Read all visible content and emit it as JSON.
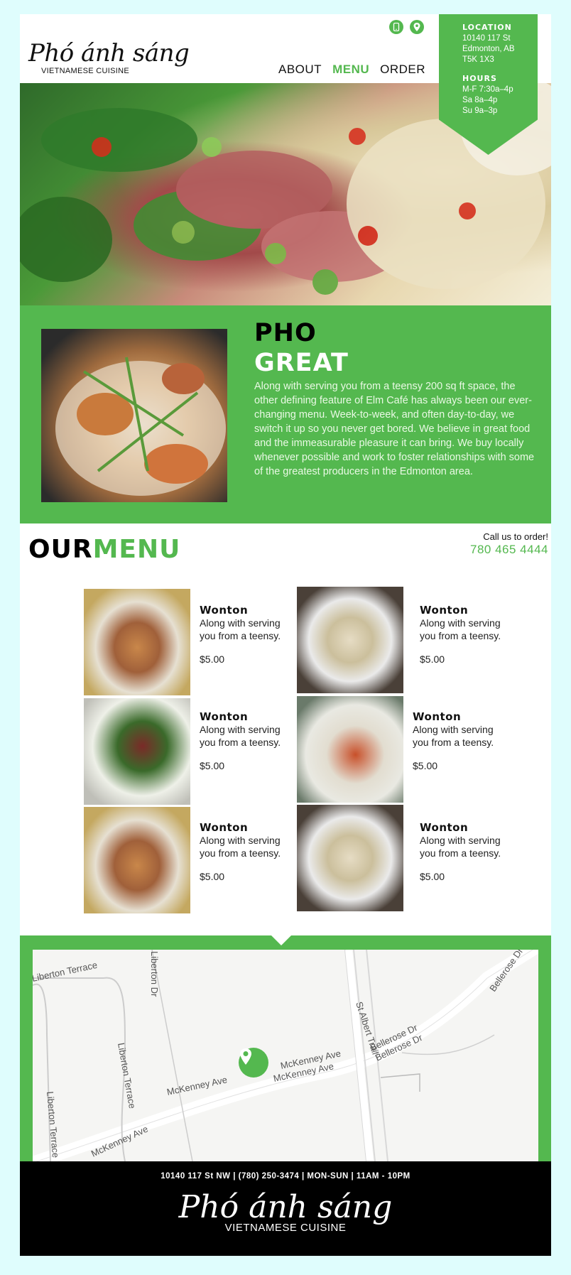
{
  "brand": {
    "name": "Phó ánh sáng",
    "tagline": "VIETNAMESE CUISINE"
  },
  "header": {
    "icons": [
      "phone-icon",
      "location-pin-icon"
    ],
    "nav": [
      {
        "label": "ABOUT",
        "active": false
      },
      {
        "label": "MENU",
        "active": true
      },
      {
        "label": "ORDER",
        "active": false
      }
    ]
  },
  "info": {
    "location_title": "LOCATION",
    "address": [
      "10140 117 St",
      "Edmonton, AB",
      "T5K 1X3"
    ],
    "hours_title": "HOURS",
    "hours": [
      "M-F 7:30a–4p",
      "Sa 8a–4p",
      "Su 9a–3p"
    ]
  },
  "intro": {
    "title_1": "PHO",
    "title_2": "GREAT",
    "text": "Along with serving you from a teensy 200 sq ft space, the other defining feature of Elm Café has always been our ever-changing menu. Week-to-week, and often day-to-day, we switch it up so you never get bored. We believe in great food and the immeasurable pleasure it can bring. We buy locally whenever possible and work to foster relationships with some of the greatest producers in the Edmonton area."
  },
  "menu": {
    "title_1": "OUR",
    "title_2": "MENU",
    "call_label": "Call us to order!",
    "call_number": "780 465 4444",
    "items": [
      {
        "name": "Wonton",
        "desc": "Along with serving you from a teensy.",
        "price": "$5.00"
      },
      {
        "name": "Wonton",
        "desc": "Along with serving you from a teensy.",
        "price": "$5.00"
      },
      {
        "name": "Wonton",
        "desc": "Along with serving you from a teensy.",
        "price": "$5.00"
      },
      {
        "name": "Wonton",
        "desc": "Along with serving you from a teensy.",
        "price": "$5.00"
      },
      {
        "name": "Wonton",
        "desc": "Along with serving you from a teensy.",
        "price": "$5.00"
      },
      {
        "name": "Wonton",
        "desc": "Along with serving you from a teensy.",
        "price": "$5.00"
      }
    ]
  },
  "map": {
    "labels": [
      "Liberton Terrace",
      "Liberton Dr",
      "Liberton Terrace",
      "Liberton Terrace",
      "McKenney Ave",
      "McKenney Ave",
      "McKenney Ave",
      "McKenney Ave",
      "St Albert Trail",
      "Bellerose Dr",
      "Bellerose Dr",
      "Bellerose Dr"
    ]
  },
  "footer": {
    "line": "10140 117 St NW | (780) 250-3474 | MON-SUN | 11AM - 10PM",
    "brand": "Phó ánh sáng",
    "tagline": "VIETNAMESE CUISINE"
  },
  "colors": {
    "accent": "#54b84f",
    "page_bg": "#dffdfd",
    "footer_bg": "#000000"
  }
}
